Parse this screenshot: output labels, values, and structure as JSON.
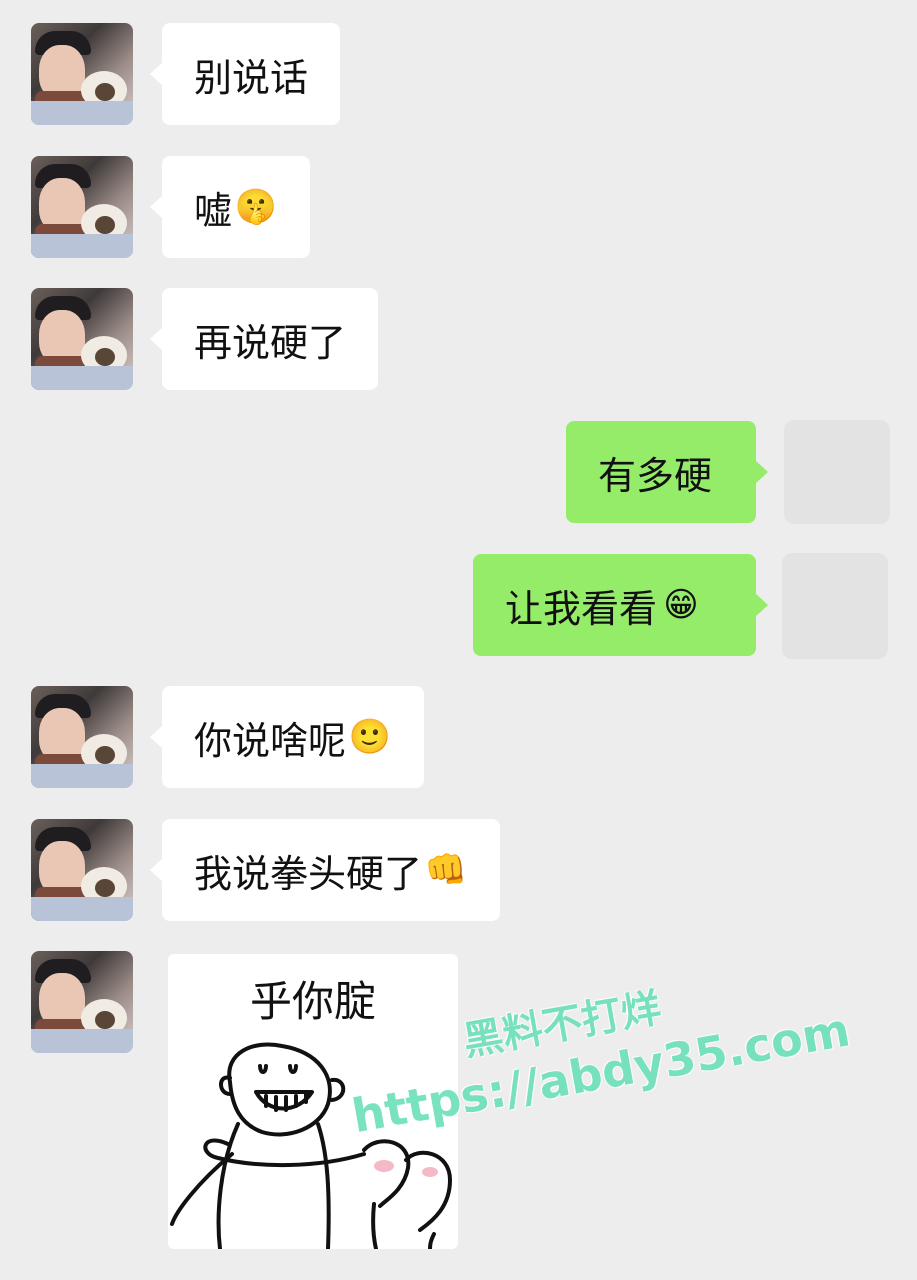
{
  "conversation": {
    "messages": [
      {
        "side": "in",
        "text": "别说话",
        "emoji": ""
      },
      {
        "side": "in",
        "text": "嘘",
        "emoji": "🤫"
      },
      {
        "side": "in",
        "text": "再说硬了",
        "emoji": ""
      },
      {
        "side": "out",
        "text": "有多硬",
        "emoji": ""
      },
      {
        "side": "out",
        "text": "让我看看",
        "emoji": "😁"
      },
      {
        "side": "in",
        "text": "你说啥呢",
        "emoji": "🙂"
      },
      {
        "side": "in",
        "text": "我说拳头硬了",
        "emoji": "👊"
      }
    ],
    "sticker": {
      "caption": "乎你腚"
    }
  },
  "watermark": {
    "line1": "黑料不打烊",
    "line2": "https://abdy35.com",
    "color": "#6ee0b9"
  },
  "colors": {
    "background": "#ededed",
    "incoming_bubble": "#ffffff",
    "outgoing_bubble": "#95ec69"
  }
}
